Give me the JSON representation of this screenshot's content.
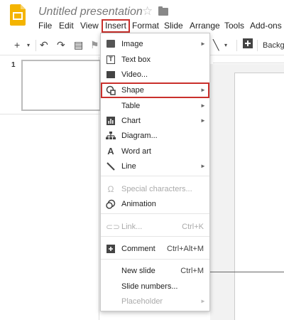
{
  "header": {
    "title": "Untitled presentation",
    "star_icon": "star-outline-icon",
    "folder_icon": "folder-icon",
    "logo_color": "#F4B400"
  },
  "menubar": {
    "items": [
      "File",
      "Edit",
      "View",
      "Insert",
      "Format",
      "Slide",
      "Arrange",
      "Tools",
      "Add-ons"
    ],
    "active": "Insert"
  },
  "toolbar": {
    "background_label": "Backgr"
  },
  "filmstrip": {
    "slide_number": "1"
  },
  "insert_menu": {
    "items": [
      {
        "label": "Image",
        "icon": "image-icon",
        "submenu": true
      },
      {
        "label": "Text box",
        "icon": "textbox-icon"
      },
      {
        "label": "Video...",
        "icon": "video-icon"
      },
      {
        "label": "Shape",
        "icon": "shape-icon",
        "submenu": true,
        "highlighted": true
      },
      {
        "label": "Table",
        "icon": "",
        "submenu": true
      },
      {
        "label": "Chart",
        "icon": "chart-icon",
        "submenu": true
      },
      {
        "label": "Diagram...",
        "icon": "diagram-icon"
      },
      {
        "label": "Word art",
        "icon": "wordart-icon"
      },
      {
        "label": "Line",
        "icon": "line-icon",
        "submenu": true
      },
      {
        "label": "Special characters...",
        "icon": "omega-icon",
        "disabled": true
      },
      {
        "label": "Animation",
        "icon": "animation-icon"
      },
      {
        "label": "Link...",
        "icon": "link-icon",
        "disabled": true,
        "shortcut": "Ctrl+K"
      },
      {
        "label": "Comment",
        "icon": "comment-icon",
        "shortcut": "Ctrl+Alt+M"
      },
      {
        "label": "New slide",
        "icon": "",
        "shortcut": "Ctrl+M"
      },
      {
        "label": "Slide numbers...",
        "icon": ""
      },
      {
        "label": "Placeholder",
        "icon": "",
        "disabled": true,
        "submenu": true
      }
    ]
  },
  "colors": {
    "highlight_border": "#c9302c"
  }
}
